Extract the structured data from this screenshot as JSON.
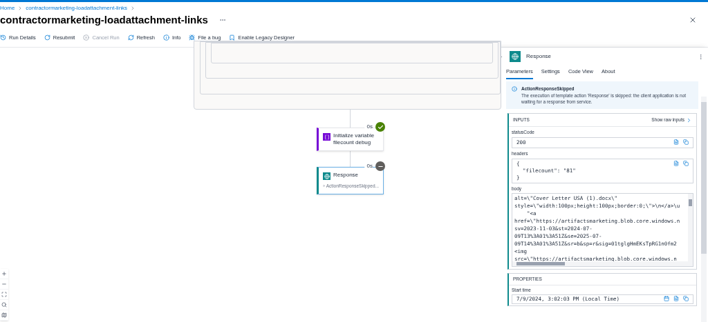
{
  "breadcrumb": [
    {
      "label": "Home"
    },
    {
      "label": "contractormarketing-loadattachment-links"
    }
  ],
  "title": "contractormarketing-loadattachment-links",
  "toolbar": [
    {
      "label": "Run Details",
      "disabled": false
    },
    {
      "label": "Resubmit",
      "disabled": false
    },
    {
      "label": "Cancel Run",
      "disabled": true
    },
    {
      "label": "Refresh",
      "disabled": false
    },
    {
      "label": "Info",
      "disabled": false
    },
    {
      "label": "File a bug",
      "disabled": false
    },
    {
      "label": "Enable Legacy Designer",
      "disabled": false
    }
  ],
  "nodes": [
    {
      "kind": "variable",
      "title": "Initialize variable filecount debug",
      "duration": "0s",
      "skipped": false,
      "selected": false
    },
    {
      "kind": "response",
      "title": "Response",
      "subtitle": "ActionResponseSkipped...",
      "duration": "0s",
      "skipped": true,
      "selected": true
    }
  ],
  "panel": {
    "title": "Response",
    "tabs": [
      {
        "label": "Parameters",
        "selected": true
      },
      {
        "label": "Settings",
        "selected": false
      },
      {
        "label": "Code View",
        "selected": false
      },
      {
        "label": "About",
        "selected": false
      }
    ],
    "notice": {
      "title": "ActionResponseSkipped",
      "text": "The execution of template action 'Response' is skipped: the client application is not waiting for a response from service."
    },
    "inputs": {
      "heading": "INPUTS",
      "raw_link": "Show raw inputs",
      "fields": [
        {
          "label": "statusCode",
          "lines": [
            "200"
          ],
          "kind": "text"
        },
        {
          "label": "headers",
          "lines": [
            "{",
            "  \"filecount\": \"81\"",
            "}"
          ],
          "kind": "text"
        },
        {
          "label": "body",
          "kind": "scroll",
          "lines": [
            "alt=\\\"Cover Letter USA (1).docx\\\"",
            "style=\\\"width:100px;height:100px;border:0;\\\">\\n</a>\\u",
            "    \"<a",
            "href=\\\"https://artifactsmarketing.blob.core.windows.n",
            "sv=2023-11-03&st=2024-07-",
            "09T13%3A01%3A51Z&se=2025-07-",
            "09T14%3A01%3A51Z&sr=b&sp=r&sig=01tglgHmEKsTpRG1n0fm2",
            "<img",
            "src=\\\"https://artifactsmarketing.blob.core.windows.n"
          ]
        }
      ]
    },
    "properties": {
      "heading": "PROPERTIES",
      "fields": [
        {
          "label": "Start time",
          "value": "7/9/2024, 3:02:03 PM (Local Time)"
        }
      ]
    }
  }
}
